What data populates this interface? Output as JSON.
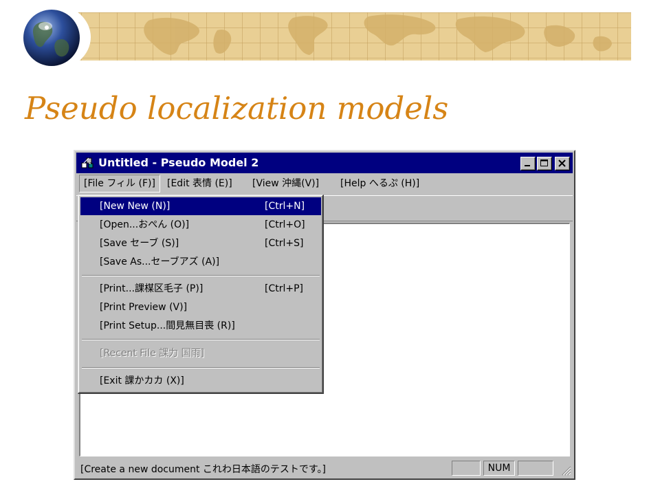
{
  "slide": {
    "title": "Pseudo localization models"
  },
  "window": {
    "title": "Untitled - Pseudo Model 2",
    "controls": [
      "minimize-icon",
      "maximize-icon",
      "close-icon"
    ]
  },
  "menubar": {
    "items": [
      {
        "label": "[File フィル (F)]"
      },
      {
        "label": "[Edit 表情 (E)]"
      },
      {
        "label": "[View 沖縄(V)]"
      },
      {
        "label": "[Help へるぷ (H)]"
      }
    ]
  },
  "file_menu": {
    "items": [
      {
        "label": "[New  New (N)]",
        "shortcut": "[Ctrl+N]",
        "state": "selected"
      },
      {
        "label": "[Open...おぺん (O)]",
        "shortcut": "[Ctrl+O]",
        "state": "normal"
      },
      {
        "label": "[Save セーブ (S)]",
        "shortcut": "[Ctrl+S]",
        "state": "normal"
      },
      {
        "label": "[Save As...セーブアズ (A)]",
        "shortcut": "",
        "state": "normal"
      },
      {
        "label": "[Print...課楳区毛子 (P)]",
        "shortcut": "[Ctrl+P]",
        "state": "normal"
      },
      {
        "label": "[Print  Preview (V)]",
        "shortcut": "",
        "state": "normal"
      },
      {
        "label": "[Print Setup...間見無目喪 (R)]",
        "shortcut": "",
        "state": "normal"
      },
      {
        "label": "[Recent File  課力  国雨]",
        "shortcut": "",
        "state": "disabled"
      },
      {
        "label": "[Exit 課かカカ (X)]",
        "shortcut": "",
        "state": "normal"
      }
    ]
  },
  "statusbar": {
    "text": "[Create a new document これわ日本語のテストです。]",
    "num_indicator": "NUM"
  },
  "colors": {
    "title_accent": "#d68416",
    "titlebar": "#000080",
    "menu_highlight": "#000080",
    "face": "#c0c0c0"
  }
}
